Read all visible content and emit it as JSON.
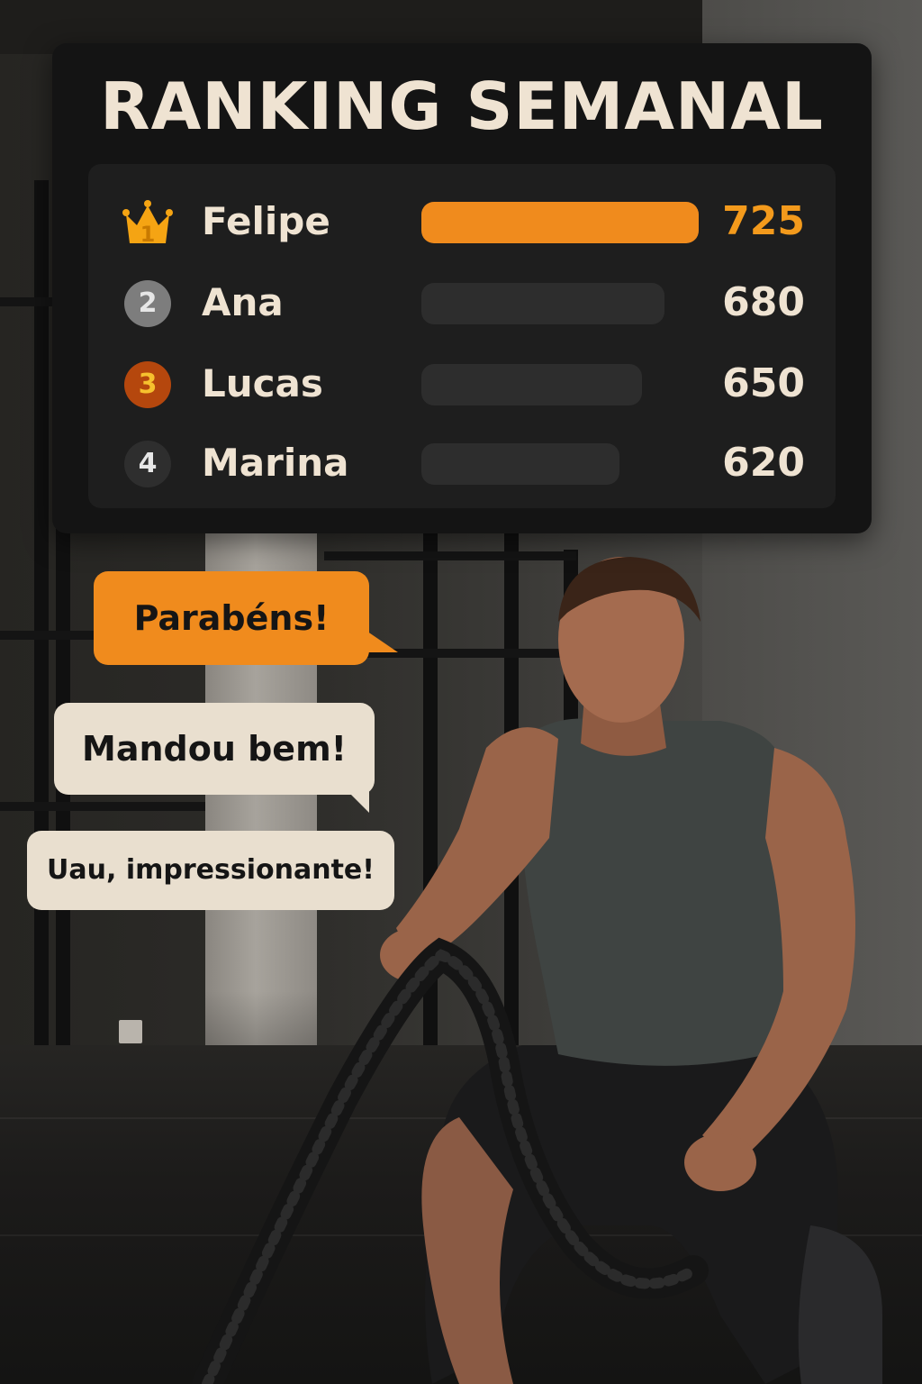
{
  "ranking": {
    "title": "RANKING SEMANAL",
    "max_score": 725,
    "players": [
      {
        "position": "1",
        "name": "Felipe",
        "score": "725",
        "value": 725,
        "badge": "crown-icon",
        "accent": "#f08b1d",
        "score_color": "#f39a1c"
      },
      {
        "position": "2",
        "name": "Ana",
        "score": "680",
        "value": 680,
        "badge": "silver",
        "accent": "#7d7d7d",
        "score_color": "#efe3d2"
      },
      {
        "position": "3",
        "name": "Lucas",
        "score": "650",
        "value": 650,
        "badge": "bronze",
        "accent": "#b5470d",
        "score_color": "#efe3d2"
      },
      {
        "position": "4",
        "name": "Marina",
        "score": "620",
        "value": 620,
        "badge": "plain",
        "accent": "#2e2e2e",
        "score_color": "#efe3d2"
      }
    ]
  },
  "chat": {
    "messages": [
      {
        "text": "Parabéns!",
        "style": "accent"
      },
      {
        "text": "Mandou bem!",
        "style": "light"
      },
      {
        "text": "Uau, impressionante!",
        "style": "light"
      }
    ]
  },
  "colors": {
    "accent": "#f08b1d",
    "card_bg": "#141414",
    "text_light": "#efe3d2"
  }
}
